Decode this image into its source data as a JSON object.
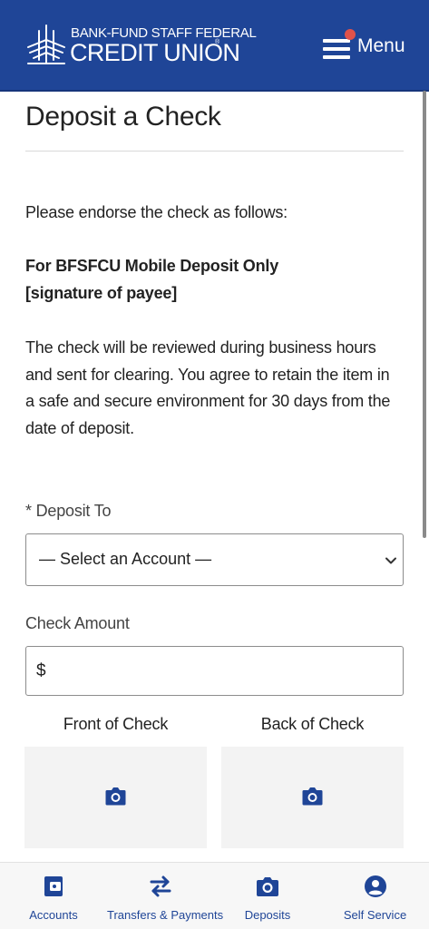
{
  "header": {
    "brand_top": "BANK-FUND STAFF FEDERAL",
    "brand_main": "CREDIT UNION",
    "brand_reg": "®",
    "menu_label": "Menu",
    "brand_color": "#1f4597",
    "notification_color": "#e0524a",
    "icons": [
      "logo-icon",
      "hamburger-icon"
    ]
  },
  "page": {
    "title": "Deposit a Check",
    "endorse_intro": "Please endorse the check as follows:",
    "endorse_line1": "For BFSFCU Mobile Deposit Only",
    "endorse_line2": "[signature of payee]",
    "review_text": "The check will be reviewed during business hours and sent for clearing. You agree to retain the item in a safe and secure environment for 30 days from the date of deposit."
  },
  "form": {
    "deposit_to_label": "* Deposit To",
    "deposit_to_value": "— Select an Account —",
    "check_amount_label": "Check Amount",
    "currency_symbol": "$",
    "amount_value": "",
    "front_label": "Front of Check",
    "back_label": "Back of Check",
    "icons": [
      "chevron-down-icon",
      "camera-icon"
    ]
  },
  "bottom_nav": {
    "items": [
      {
        "label": "Accounts",
        "icon": "wallet-icon"
      },
      {
        "label": "Transfers & Payments",
        "icon": "transfer-arrows-icon"
      },
      {
        "label": "Deposits",
        "icon": "camera-icon"
      },
      {
        "label": "Self Service",
        "icon": "user-circle-icon"
      }
    ],
    "accent_color": "#1f4597"
  }
}
